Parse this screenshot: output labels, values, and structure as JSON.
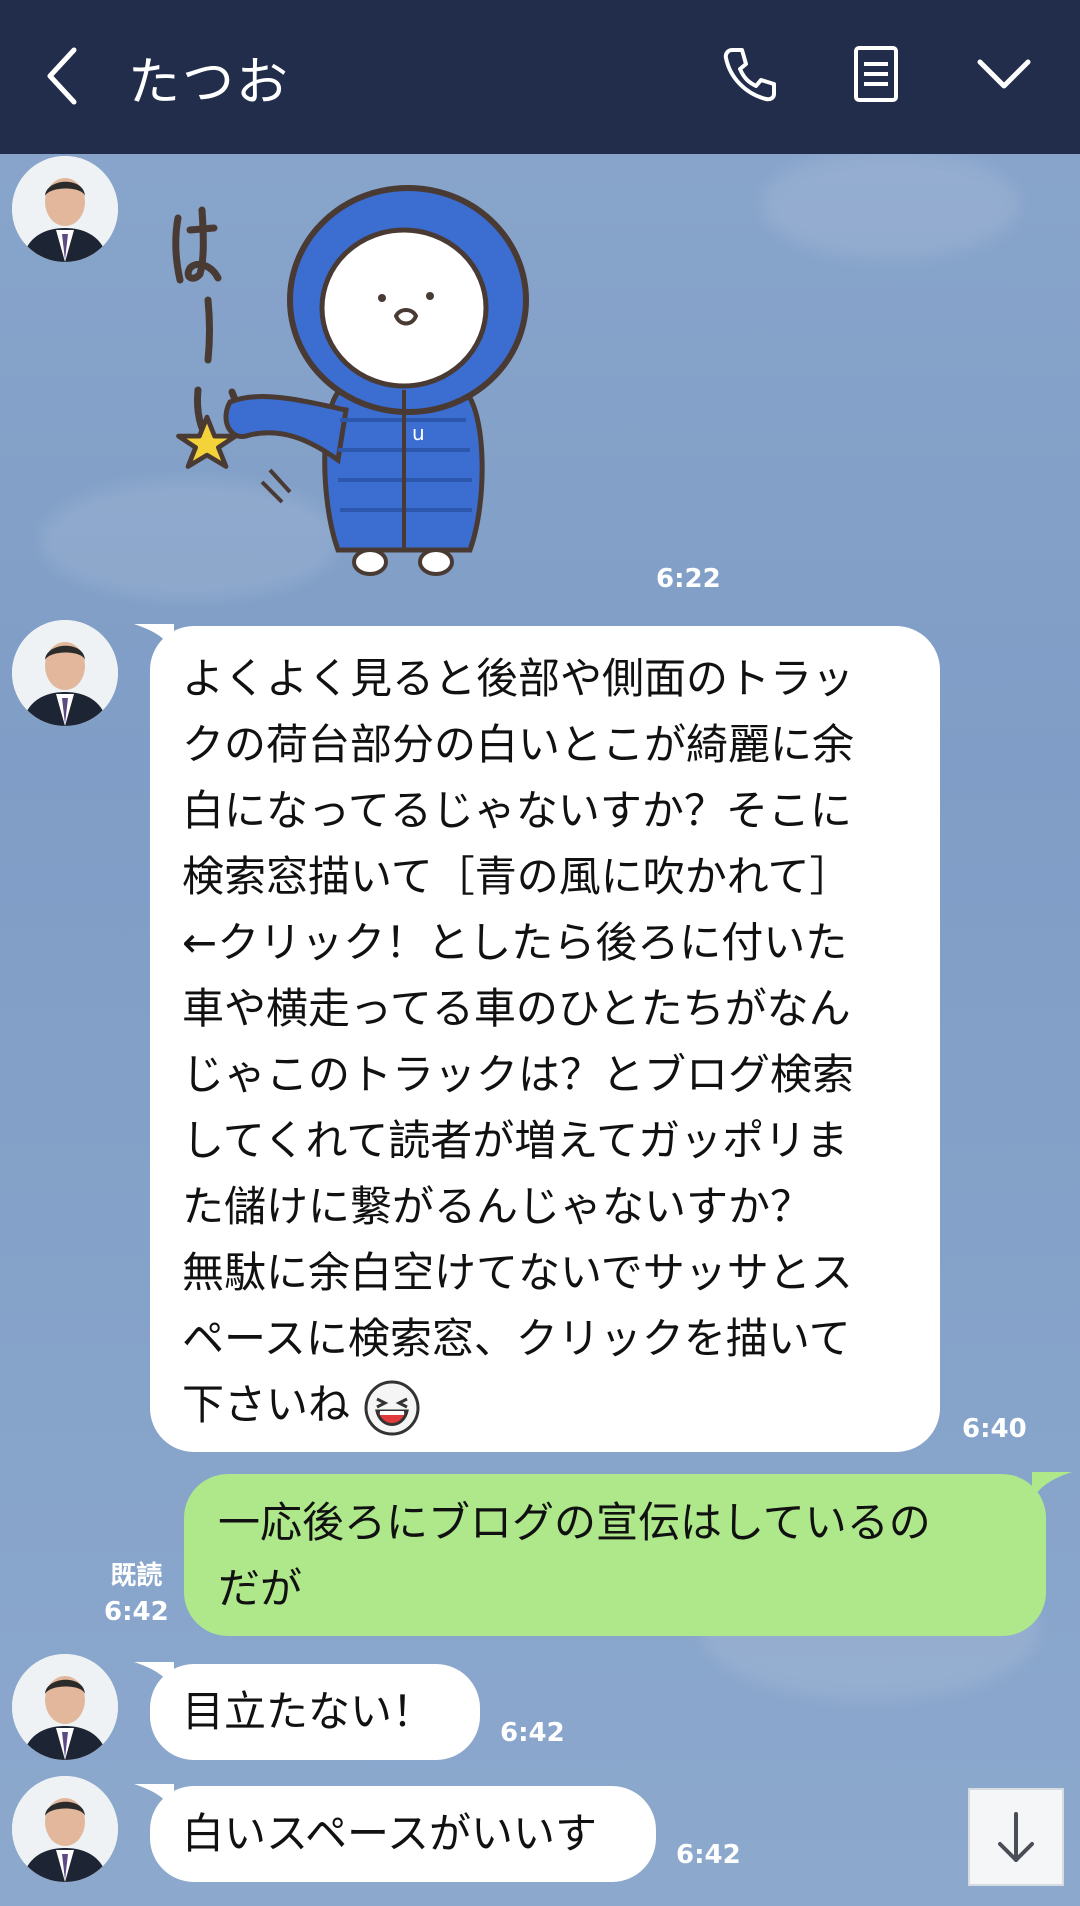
{
  "header": {
    "title": "たつお",
    "icons": [
      "back-icon",
      "phone-icon",
      "notes-icon",
      "chevron-down-icon"
    ]
  },
  "messages": [
    {
      "type": "sticker",
      "time": "6:22"
    },
    {
      "type": "text",
      "time": "6:40",
      "lines": [
        "よくよく見ると後部や側面のトラッ",
        "クの荷台部分の白いとこが綺麗に余",
        "白になってるじゃないすか？そこに",
        "検索窓描いて［青の風に吹かれて］",
        "←クリック！としたら後ろに付いた",
        "車や横走ってる車のひとたちがなん",
        "じゃこのトラックは？とブログ検索",
        "してくれて読者が増えてガッポリま",
        "た儲けに繋がるんじゃないすか？",
        "無駄に余白空けてないでサッサとス",
        "ペースに検索窓、クリックを描いて",
        "下さいね"
      ]
    },
    {
      "type": "own",
      "time": "6:42",
      "read": "既読",
      "lines": [
        "一応後ろにブログの宣伝はしているの",
        "だが"
      ]
    },
    {
      "type": "text",
      "time": "6:42",
      "text": "目立たない！"
    },
    {
      "type": "text",
      "time": "6:42",
      "text": "白いスペースがいいす"
    }
  ],
  "sticker_text": "は〜い",
  "colors": {
    "header": "#212d4a",
    "bubble_own": "#aee88b",
    "bubble_other": "#ffffff",
    "background": "#8aa6cc"
  }
}
